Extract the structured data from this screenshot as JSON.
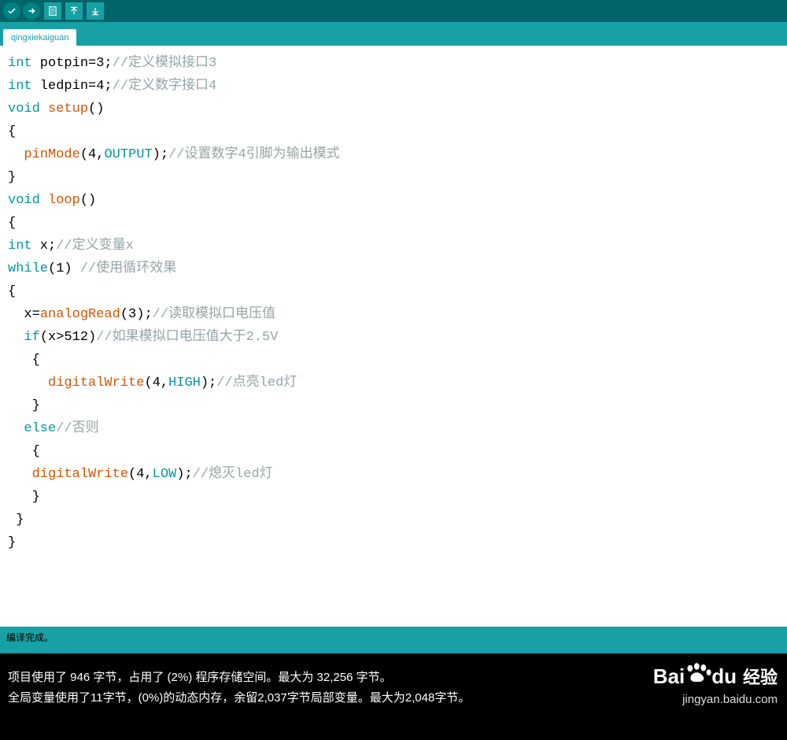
{
  "tab": {
    "name": "qingxiekaiguan"
  },
  "code": [
    [
      [
        "kw",
        "int"
      ],
      [
        "",
        " potpin=3;"
      ],
      [
        "cm",
        "//定义模拟接口3"
      ]
    ],
    [
      [
        "kw",
        "int"
      ],
      [
        "",
        " ledpin=4;"
      ],
      [
        "cm",
        "//定义数字接口4"
      ]
    ],
    [
      [
        "kw",
        "void"
      ],
      [
        "",
        " "
      ],
      [
        "fn",
        "setup"
      ],
      [
        "",
        "()"
      ]
    ],
    [
      [
        "",
        "{"
      ]
    ],
    [
      [
        "",
        "  "
      ],
      [
        "fn",
        "pinMode"
      ],
      [
        "",
        "(4,"
      ],
      [
        "const",
        "OUTPUT"
      ],
      [
        "",
        ");"
      ],
      [
        "cm",
        "//设置数字4引脚为输出模式"
      ]
    ],
    [
      [
        "",
        "}"
      ]
    ],
    [
      [
        "kw",
        "void"
      ],
      [
        "",
        " "
      ],
      [
        "fn",
        "loop"
      ],
      [
        "",
        "()"
      ]
    ],
    [
      [
        "",
        "{"
      ]
    ],
    [
      [
        "kw",
        "int"
      ],
      [
        "",
        " x;"
      ],
      [
        "cm",
        "//定义变量x"
      ]
    ],
    [
      [
        "kw",
        "while"
      ],
      [
        "",
        "(1) "
      ],
      [
        "cm",
        "//使用循环效果"
      ]
    ],
    [
      [
        "",
        "{"
      ]
    ],
    [
      [
        "",
        "  x="
      ],
      [
        "fn",
        "analogRead"
      ],
      [
        "",
        "(3);"
      ],
      [
        "cm",
        "//读取模拟口电压值"
      ]
    ],
    [
      [
        "",
        "  "
      ],
      [
        "kw",
        "if"
      ],
      [
        "",
        "(x>512)"
      ],
      [
        "cm",
        "//如果模拟口电压值大于2.5V"
      ]
    ],
    [
      [
        "",
        "   {"
      ]
    ],
    [
      [
        "",
        "     "
      ],
      [
        "fn",
        "digitalWrite"
      ],
      [
        "",
        "(4,"
      ],
      [
        "const",
        "HIGH"
      ],
      [
        "",
        ");"
      ],
      [
        "cm",
        "//点亮led灯"
      ]
    ],
    [
      [
        "",
        "   }"
      ]
    ],
    [
      [
        "",
        "  "
      ],
      [
        "kw",
        "else"
      ],
      [
        "cm",
        "//否则"
      ]
    ],
    [
      [
        "",
        "   {"
      ]
    ],
    [
      [
        "",
        "   "
      ],
      [
        "fn",
        "digitalWrite"
      ],
      [
        "",
        "(4,"
      ],
      [
        "const",
        "LOW"
      ],
      [
        "",
        ");"
      ],
      [
        "cm",
        "//熄灭led灯"
      ]
    ],
    [
      [
        "",
        "   }"
      ]
    ],
    [
      [
        "",
        " }"
      ]
    ],
    [
      [
        "",
        "}"
      ]
    ]
  ],
  "status": "编译完成。",
  "console": {
    "line1": "项目使用了 946 字节，占用了 (2%) 程序存储空间。最大为 32,256 字节。",
    "line2": "全局变量使用了11字节，(0%)的动态内存，余留2,037字节局部变量。最大为2,048字节。"
  },
  "watermark": {
    "brand": "Bai",
    "du": "du",
    "cn": "经验",
    "url": "jingyan.baidu.com"
  }
}
